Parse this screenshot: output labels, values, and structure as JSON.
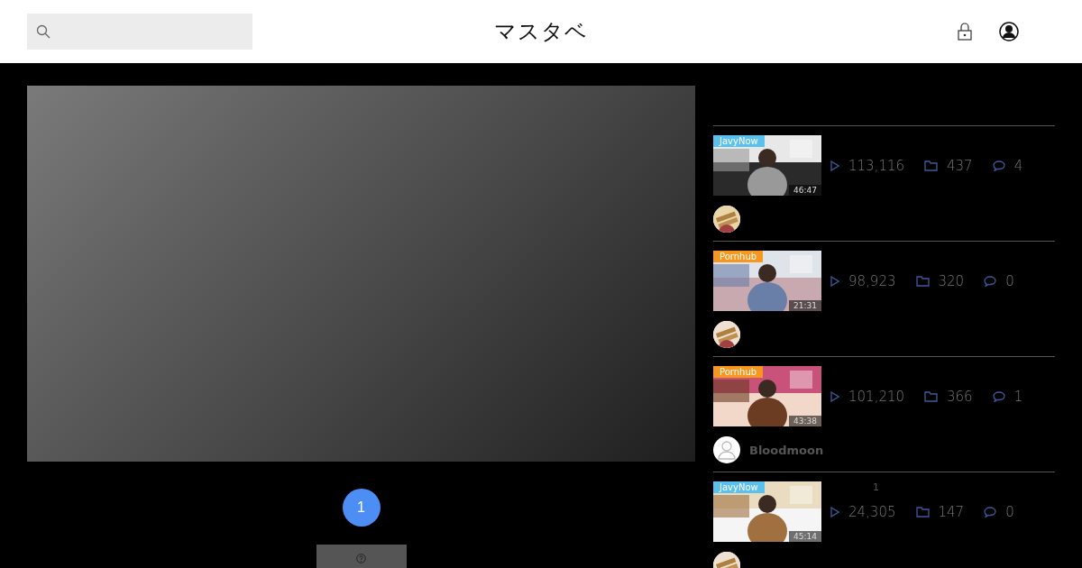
{
  "header": {
    "logo": "マスタベ"
  },
  "pagination": [
    {
      "label": "1",
      "selected": true
    }
  ],
  "videos": [
    {
      "source": "JavyNow",
      "color": "#5bc0eb",
      "duration": "46:47",
      "views": "113,116",
      "saves": "437",
      "comments": "4"
    },
    {
      "source": "Pornhub",
      "color": "#f7971e",
      "duration": "21:31",
      "views": "98,923",
      "saves": "320",
      "comments": "0"
    },
    {
      "source": "Pornhub",
      "color": "#f7971e",
      "duration": "43:38",
      "views": "101,210",
      "saves": "366",
      "comments": "1",
      "avatar": {
        "kind": "default"
      },
      "user": "Bloodmoon"
    },
    {
      "source": "JavyNow",
      "color": "#5bc0eb",
      "duration": "45:14",
      "views": "24,305",
      "saves": "147",
      "comments": "0",
      "note": "1"
    }
  ]
}
